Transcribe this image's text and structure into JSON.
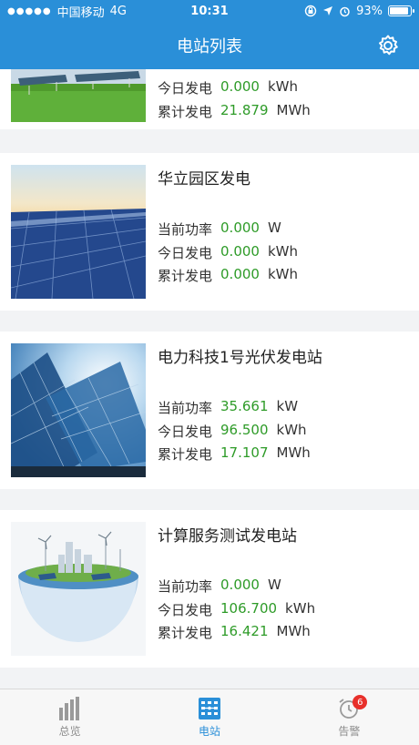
{
  "status_bar": {
    "carrier": "中国移动",
    "network": "4G",
    "time": "10:31",
    "battery_percent": "93%",
    "battery_level": 0.93
  },
  "header": {
    "title": "电站列表",
    "settings_icon": "gear-icon"
  },
  "stations": [
    {
      "name": "",
      "metrics": [
        {
          "label": "今日发电",
          "value": "0.000",
          "unit": "kWh"
        },
        {
          "label": "累计发电",
          "value": "21.879",
          "unit": "MWh"
        }
      ]
    },
    {
      "name": "华立园区发电",
      "metrics": [
        {
          "label": "当前功率",
          "value": "0.000",
          "unit": "W"
        },
        {
          "label": "今日发电",
          "value": "0.000",
          "unit": "kWh"
        },
        {
          "label": "累计发电",
          "value": "0.000",
          "unit": "kWh"
        }
      ]
    },
    {
      "name": "电力科技1号光伏发电站",
      "metrics": [
        {
          "label": "当前功率",
          "value": "35.661",
          "unit": "kW"
        },
        {
          "label": "今日发电",
          "value": "96.500",
          "unit": "kWh"
        },
        {
          "label": "累计发电",
          "value": "17.107",
          "unit": "MWh"
        }
      ]
    },
    {
      "name": "计算服务测试发电站",
      "metrics": [
        {
          "label": "当前功率",
          "value": "0.000",
          "unit": "W"
        },
        {
          "label": "今日发电",
          "value": "106.700",
          "unit": "kWh"
        },
        {
          "label": "累计发电",
          "value": "16.421",
          "unit": "MWh"
        }
      ]
    }
  ],
  "tabbar": {
    "tabs": [
      {
        "label": "总览",
        "icon": "bar-chart-icon",
        "active": false
      },
      {
        "label": "电站",
        "icon": "station-grid-icon",
        "active": true
      },
      {
        "label": "告警",
        "icon": "alarm-clock-icon",
        "active": false,
        "badge": "6"
      }
    ]
  },
  "colors": {
    "primary": "#2a8fd8",
    "value_green": "#2e9b28",
    "badge_red": "#e8302b"
  }
}
